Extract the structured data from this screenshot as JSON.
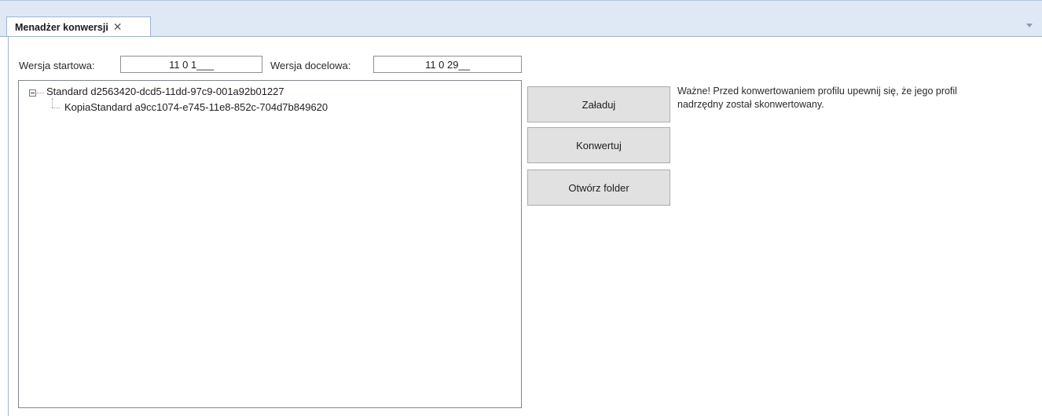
{
  "tab": {
    "title": "Menadżer konwersji",
    "close_glyph": "✕"
  },
  "versions": {
    "start_label": "Wersja startowa:",
    "start_value": "11 0 1___",
    "target_label": "Wersja docelowa:",
    "target_value": "11 0 29__"
  },
  "tree": {
    "root": {
      "label": "Standard d2563420-dcd5-11dd-97c9-001a92b01227"
    },
    "child": {
      "label": "KopiaStandard a9cc1074-e745-11e8-852c-704d7b849620"
    }
  },
  "buttons": {
    "load": "Załaduj",
    "convert": "Konwertuj",
    "open_folder": "Otwórz folder"
  },
  "note": {
    "line1": "Ważne! Przed konwertowaniem profilu upewnij się, że jego profil",
    "line2": "nadrzędny został skonwertowany."
  }
}
